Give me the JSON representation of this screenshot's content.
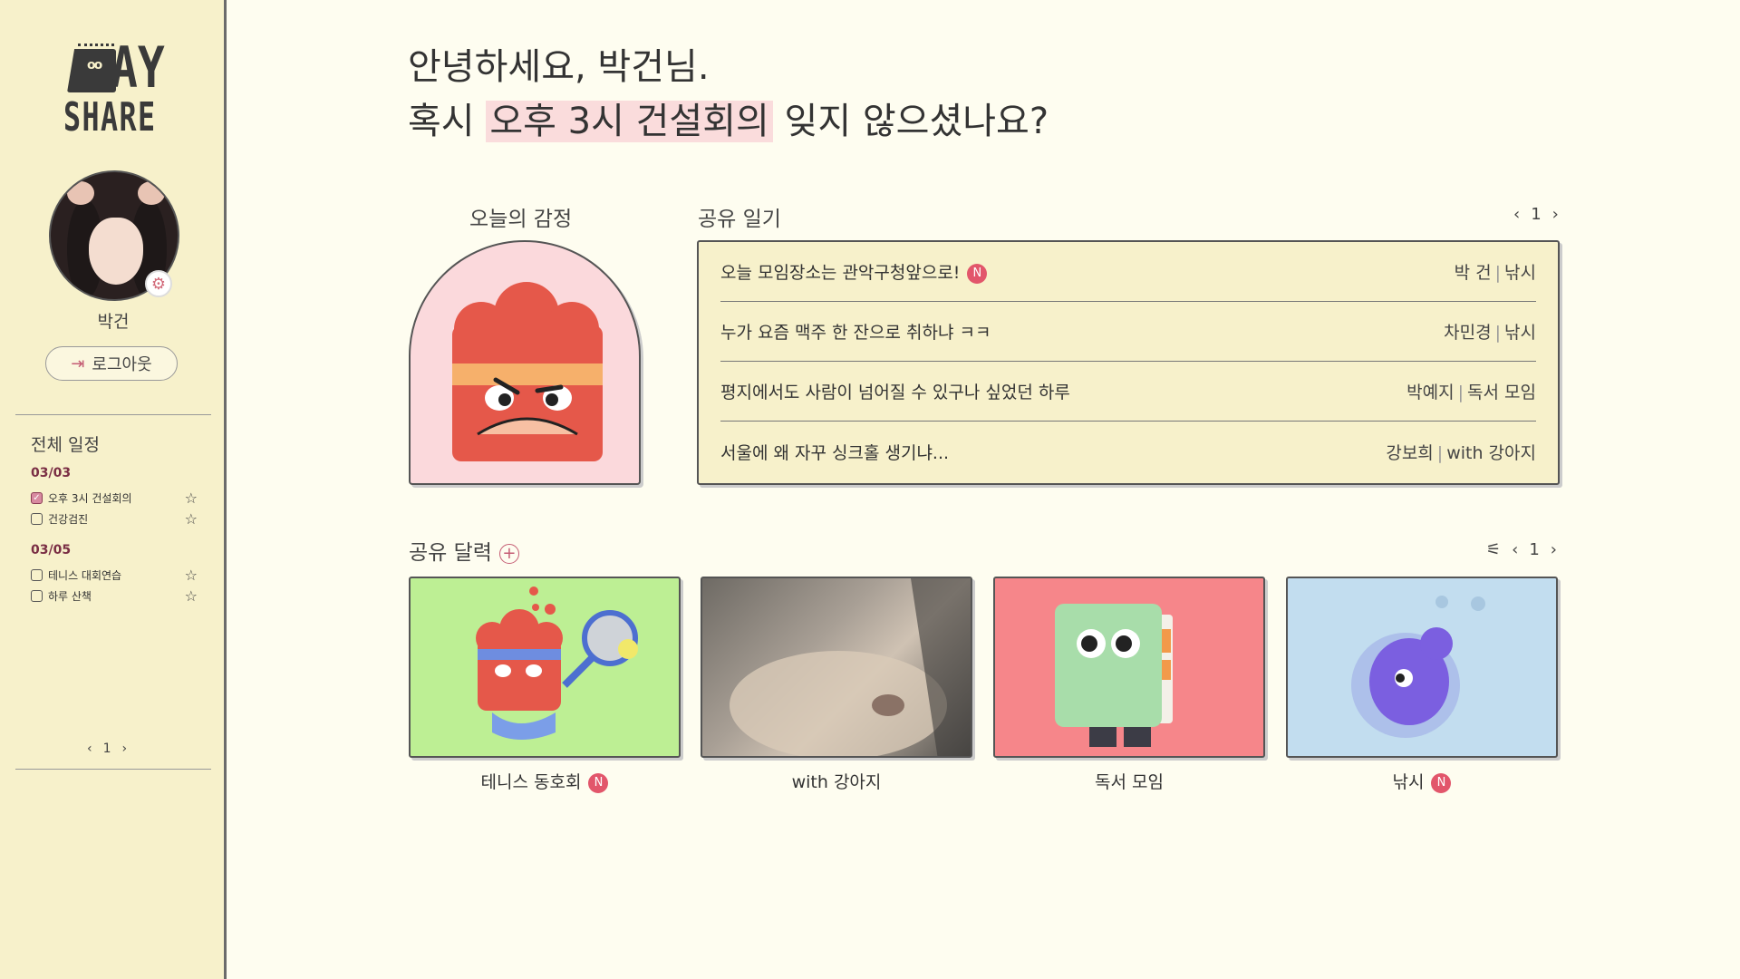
{
  "sidebar": {
    "logo_top": "AY",
    "logo_bottom": "SHARE",
    "user_name": "박건",
    "logout_label": "로그아웃",
    "schedule_title": "전체 일정",
    "groups": [
      {
        "date": "03/03",
        "items": [
          {
            "label": "오후 3시 건설회의",
            "checked": true
          },
          {
            "label": "건강검진",
            "checked": false
          }
        ]
      },
      {
        "date": "03/05",
        "items": [
          {
            "label": "테니스 대회연습",
            "checked": false
          },
          {
            "label": "하루 산책",
            "checked": false
          }
        ]
      }
    ],
    "pager": "1"
  },
  "greeting": {
    "line1": "안녕하세요, 박건님.",
    "line2_pre": "혹시 ",
    "line2_highlight": "오후 3시 건설회의",
    "line2_post": " 잊지 않으셨나요?",
    "highlight_color": "#fadcdc"
  },
  "emotion": {
    "title": "오늘의 감정"
  },
  "diary": {
    "title": "공유 일기",
    "page": "1",
    "rows": [
      {
        "title": "오늘 모임장소는 관악구청앞으로!",
        "is_new": true,
        "new_badge": "N",
        "author": "박 건",
        "group": "낚시"
      },
      {
        "title": "누가 요즘 맥주 한 잔으로 취하냐 ㅋㅋ",
        "is_new": false,
        "author": "차민경",
        "group": "낚시"
      },
      {
        "title": "평지에서도 사람이 넘어질 수 있구나 싶었던 하루",
        "is_new": false,
        "author": "박예지",
        "group": "독서 모임"
      },
      {
        "title": "서울에 왜 자꾸 싱크홀 생기냐...",
        "is_new": false,
        "author": "강보희",
        "group": "with 강아지"
      }
    ]
  },
  "calendar": {
    "title": "공유 달력",
    "page": "1",
    "cards": [
      {
        "label": "테니스 동호회",
        "is_new": true,
        "new_badge": "N",
        "bg": "#bdef94"
      },
      {
        "label": "with 강아지",
        "is_new": false,
        "bg": "#8f8a82"
      },
      {
        "label": "독서 모임",
        "is_new": false,
        "bg": "#f6868a"
      },
      {
        "label": "낚시",
        "is_new": true,
        "new_badge": "N",
        "bg": "#c2ddef"
      }
    ]
  },
  "colors": {
    "sidebar_bg": "#f7f1cb",
    "page_bg": "#fefdf0",
    "accent": "#e2566b"
  }
}
